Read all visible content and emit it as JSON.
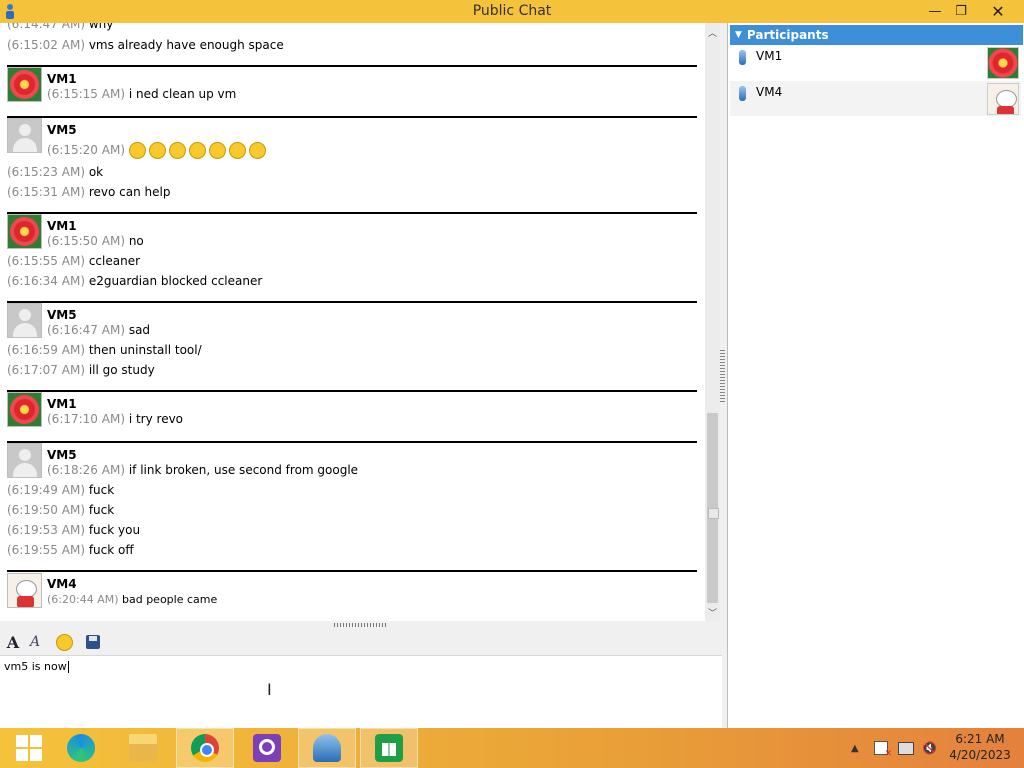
{
  "window": {
    "title": "Public Chat",
    "minimize": "—",
    "maximize": "❐",
    "close": "✕"
  },
  "chat": {
    "lines": [
      {
        "time": "(6:14:47 AM)",
        "text": "why"
      },
      {
        "time": "(6:15:02 AM)",
        "text": "vms already have enough space"
      },
      {
        "sender": "VM1",
        "time": "(6:15:15 AM)",
        "text": "i ned clean up vm"
      },
      {
        "sender": "VM5",
        "time": "(6:15:20 AM)",
        "emoji_count": 7
      },
      {
        "time": "(6:15:23 AM)",
        "text": "ok"
      },
      {
        "time": "(6:15:31 AM)",
        "text": "revo can help"
      },
      {
        "sender": "VM1",
        "time": "(6:15:50 AM)",
        "text": "no"
      },
      {
        "time": "(6:15:55 AM)",
        "text": "ccleaner"
      },
      {
        "time": "(6:16:34 AM)",
        "text": "e2guardian blocked ccleaner"
      },
      {
        "sender": "VM5",
        "time": "(6:16:47 AM)",
        "text": "sad"
      },
      {
        "time": "(6:16:59 AM)",
        "text": "then uninstall tool/"
      },
      {
        "time": "(6:17:07 AM)",
        "text": "ill go study"
      },
      {
        "sender": "VM1",
        "time": "(6:17:10 AM)",
        "text": "i try revo"
      },
      {
        "sender": "VM5",
        "time": "(6:18:26 AM)",
        "text": "if link broken, use second from google"
      },
      {
        "time": "(6:19:49 AM)",
        "text": "fuck"
      },
      {
        "time": "(6:19:50 AM)",
        "text": "fuck"
      },
      {
        "time": "(6:19:53 AM)",
        "text": "fuck you"
      },
      {
        "time": "(6:19:55 AM)",
        "text": "fuck off"
      },
      {
        "sender": "VM4",
        "time": "(6:20:44 AM)",
        "text": "bad people came"
      }
    ]
  },
  "input": {
    "value": "vm5 is now"
  },
  "participants": {
    "header": "Participants",
    "items": [
      {
        "name": "VM1",
        "avatar": "flower"
      },
      {
        "name": "VM4",
        "avatar": "lucky-cat"
      }
    ]
  },
  "taskbar": {
    "apps": [
      "start-icon",
      "edge-icon",
      "file-explorer-icon",
      "chrome-icon",
      "search-app-icon",
      "chat-app-icon",
      "store-icon"
    ],
    "active_app": "chat-app-icon",
    "clock_time": "6:21 AM",
    "clock_date": "4/20/2023"
  },
  "colors": {
    "titlebar": "#f5c33b",
    "panel_header": "#3d8fd8",
    "timestamp": "#8a8a8a"
  }
}
